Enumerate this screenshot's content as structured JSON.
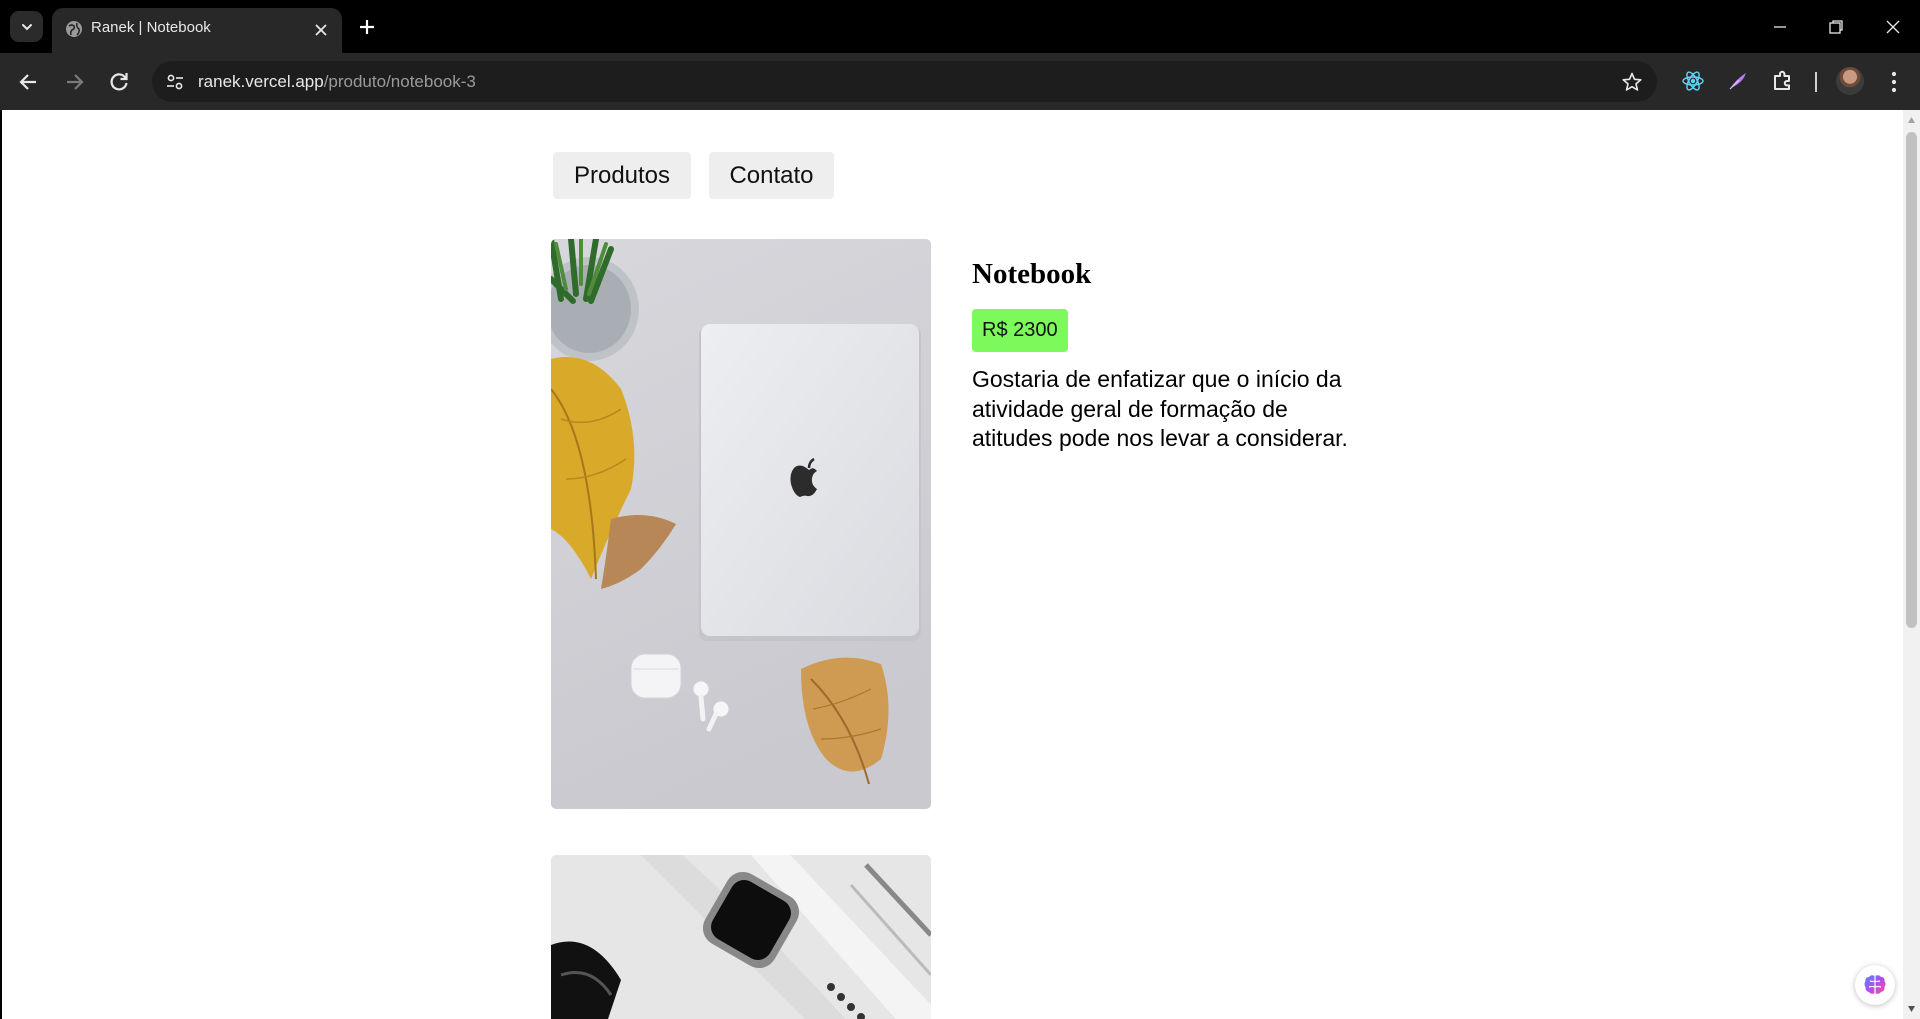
{
  "browser": {
    "tab": {
      "title": "Ranek | Notebook",
      "favicon": "globe-icon"
    },
    "address": {
      "host": "ranek.vercel.app",
      "path": "/produto/notebook-3"
    },
    "extensions": [
      "react-devtools-icon",
      "quill-extension-icon",
      "puzzle-extensions-icon"
    ]
  },
  "page": {
    "nav": {
      "produtos": "Produtos",
      "contato": "Contato"
    },
    "product": {
      "name": "Notebook",
      "price": "R$ 2300",
      "description": "Gostaria de enfatizar que o início da atividade geral de formação de atitudes pode nos levar a considerar."
    }
  },
  "colors": {
    "price_badge": "#7cfa5c",
    "nav_pill": "#eeeeee",
    "chrome": "#282828"
  }
}
